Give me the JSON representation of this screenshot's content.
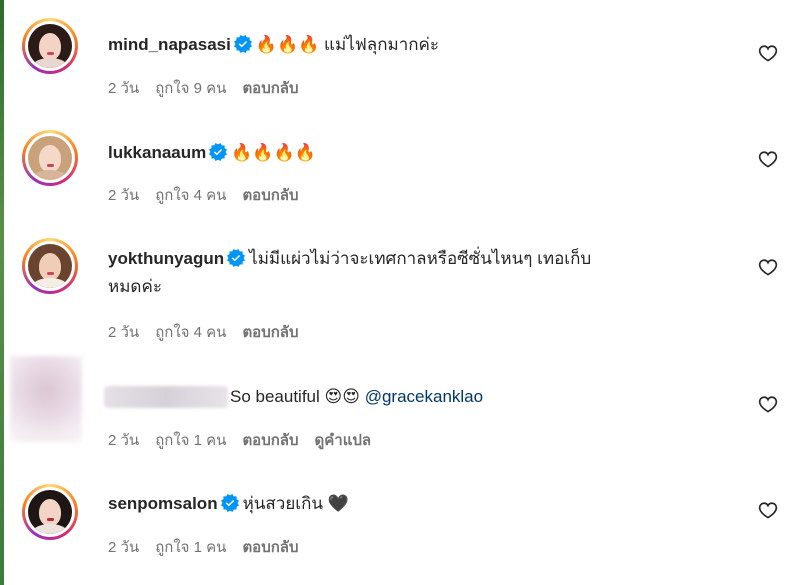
{
  "comments": [
    {
      "username": "mind_napasasi",
      "verified": true,
      "text": "🔥🔥🔥 แม่ไฟลุกมากค่ะ",
      "time": "2 วัน",
      "likes": "ถูกใจ 9 คน",
      "reply": "ตอบกลับ"
    },
    {
      "username": "lukkanaaum",
      "verified": true,
      "text": "🔥🔥🔥🔥",
      "time": "2 วัน",
      "likes": "ถูกใจ 4 คน",
      "reply": "ตอบกลับ"
    },
    {
      "username": "yokthunyagun",
      "verified": true,
      "text_line1": "ไม่มีแผ่วไม่ว่าจะเทศกาลหรือซีซั่นไหนๆ เทอเก็บ",
      "text_line2": "หมดค่ะ",
      "time": "2 วัน",
      "likes": "ถูกใจ 4 คน",
      "reply": "ตอบกลับ"
    },
    {
      "username": "",
      "blurred": true,
      "text": "So beautiful 😍😍",
      "mention": "@gracekanklao",
      "time": "2 วัน",
      "likes": "ถูกใจ 1 คน",
      "reply": "ตอบกลับ",
      "translate": "ดูคำแปล"
    },
    {
      "username": "senpomsalon",
      "verified": true,
      "text": "หุ่นสวยเกิน 🖤",
      "time": "2 วัน",
      "likes": "ถูกใจ 1 คน",
      "reply": "ตอบกลับ"
    }
  ],
  "icons": {
    "verified": "verified-badge-icon",
    "like": "heart-outline-icon"
  },
  "colors": {
    "verified_blue": "#0095f6",
    "mention": "#00376b",
    "meta_gray": "#737373"
  }
}
